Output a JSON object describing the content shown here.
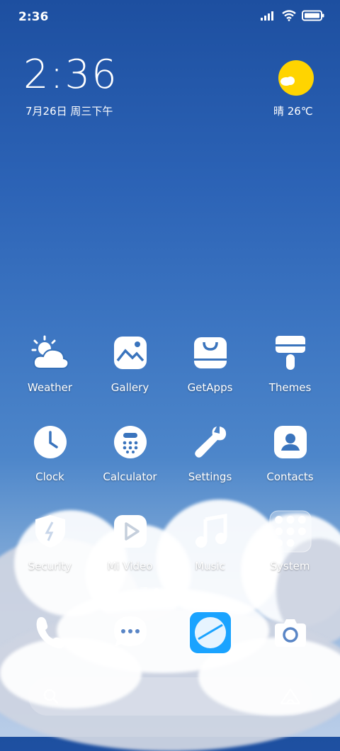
{
  "status_bar": {
    "time": "2:36"
  },
  "widget": {
    "clock": "2:36",
    "date": "7月26日 周三下午",
    "weather": "晴 26℃",
    "sun_color": "#ffd400"
  },
  "apps": [
    {
      "label": "Weather",
      "icon": "weather-icon"
    },
    {
      "label": "Gallery",
      "icon": "gallery-icon"
    },
    {
      "label": "GetApps",
      "icon": "getapps-icon"
    },
    {
      "label": "Themes",
      "icon": "themes-icon"
    },
    {
      "label": "Clock",
      "icon": "clock-icon"
    },
    {
      "label": "Calculator",
      "icon": "calculator-icon"
    },
    {
      "label": "Settings",
      "icon": "settings-icon"
    },
    {
      "label": "Contacts",
      "icon": "contacts-icon"
    },
    {
      "label": "Security",
      "icon": "security-icon"
    },
    {
      "label": "Mi Video",
      "icon": "mi-video-icon"
    },
    {
      "label": "Music",
      "icon": "music-icon"
    },
    {
      "label": "System",
      "icon": "system-folder-icon"
    }
  ],
  "dock": [
    {
      "icon": "phone-icon"
    },
    {
      "icon": "messaging-icon"
    },
    {
      "icon": "browser-icon",
      "accent": "#1aa3ff"
    },
    {
      "icon": "camera-icon"
    }
  ]
}
